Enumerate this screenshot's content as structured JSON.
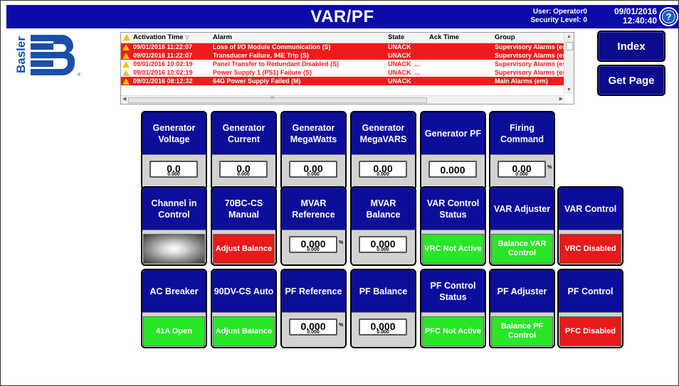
{
  "header": {
    "title": "VAR/PF",
    "user_label": "User: Operator0",
    "security_label": "Security Level: 0",
    "date": "09/01/2016",
    "time": "12:40:40",
    "help_glyph": "?"
  },
  "logo": {
    "text": "Basler",
    "mark": "B"
  },
  "alarm_table": {
    "headers": [
      "Activation Time",
      "Alarm",
      "State",
      "Ack Time",
      "Group"
    ],
    "rows": [
      {
        "time": "09/01/2016 11:22:07",
        "alarm": "Loss of I/O Module Communication (S)",
        "state": "UNACK",
        "ack_time": "",
        "group": "Supervisory Alarms (es)",
        "style": "red"
      },
      {
        "time": "09/01/2016 11:22:07",
        "alarm": "Transducer Failure, 94E Trip (S)",
        "state": "UNACK",
        "ack_time": "",
        "group": "Supervisory Alarms (es)",
        "style": "red"
      },
      {
        "time": "09/01/2016 10:02:19",
        "alarm": "Panel Transfer to Redundant Disabled (S)",
        "state": "UNACK_...",
        "ack_time": "",
        "group": "Supervisory Alarms (es)",
        "style": "white"
      },
      {
        "time": "09/01/2016 10:02:19",
        "alarm": "Power Supply 1 (PS1) Failure (S)",
        "state": "UNACK_...",
        "ack_time": "",
        "group": "Supervisory Alarms (es)",
        "style": "white"
      },
      {
        "time": "09/01/2016 08:12:32",
        "alarm": "64G Power Supply Failed (M)",
        "state": "UNACK",
        "ack_time": "",
        "group": "Main Alarms (em)",
        "style": "red"
      }
    ],
    "scroll_grip": "III"
  },
  "nav": {
    "index_label": "Index",
    "getpage_label": "Get Page"
  },
  "tiles": {
    "gen_voltage": {
      "label": "Generator Voltage",
      "value": "0.0",
      "sub": "0.000"
    },
    "gen_current": {
      "label": "Generator Current",
      "value": "0.0",
      "sub": "0.000"
    },
    "gen_mw": {
      "label": "Generator MegaWatts",
      "value": "0.00",
      "sub": "0.000"
    },
    "gen_mvars": {
      "label": "Generator MegaVARS",
      "value": "0.00",
      "sub": "0.000"
    },
    "gen_pf": {
      "label": "Generator PF",
      "value": "0.000"
    },
    "firing_cmd": {
      "label": "Firing Command",
      "value": "0.00",
      "sub": "0.000",
      "unit": "%"
    },
    "channel_ctrl": {
      "label": "Channel in Control"
    },
    "bc70_manual": {
      "label": "70BC-CS Manual",
      "status": "Adjust Balance",
      "color": "#e61b1b"
    },
    "mvar_ref": {
      "label": "MVAR Reference",
      "value": "0.000",
      "sub": "0.000",
      "unit": "%"
    },
    "mvar_bal": {
      "label": "MVAR Balance",
      "value": "0.000",
      "sub": "0.000"
    },
    "var_ctrl_status": {
      "label": "VAR Control Status",
      "status": "VRC Not Active",
      "color": "#29e629"
    },
    "var_adjuster": {
      "label": "VAR Adjuster",
      "status": "Balance VAR Control",
      "color": "#29e629"
    },
    "var_control": {
      "label": "VAR Control",
      "status": "VRC Disabled",
      "color": "#e61b1b"
    },
    "ac_breaker": {
      "label": "AC Breaker",
      "status": "41A Open",
      "color": "#29e629"
    },
    "dv90_auto": {
      "label": "90DV-CS Auto",
      "status": "Adjust Balance",
      "color": "#29e629"
    },
    "pf_ref": {
      "label": "PF Reference",
      "value": "0.000",
      "sub": "0.000",
      "unit": "%"
    },
    "pf_bal": {
      "label": "PF Balance",
      "value": "0.000",
      "sub": "0.000"
    },
    "pf_ctrl_status": {
      "label": "PF Control Status",
      "status": "PFC Not Active",
      "color": "#29e629"
    },
    "pf_adjuster": {
      "label": "PF Adjuster",
      "status": "Balance PF Control",
      "color": "#29e629"
    },
    "pf_control": {
      "label": "PF Control",
      "status": "PFC Disabled",
      "color": "#e61b1b"
    }
  }
}
